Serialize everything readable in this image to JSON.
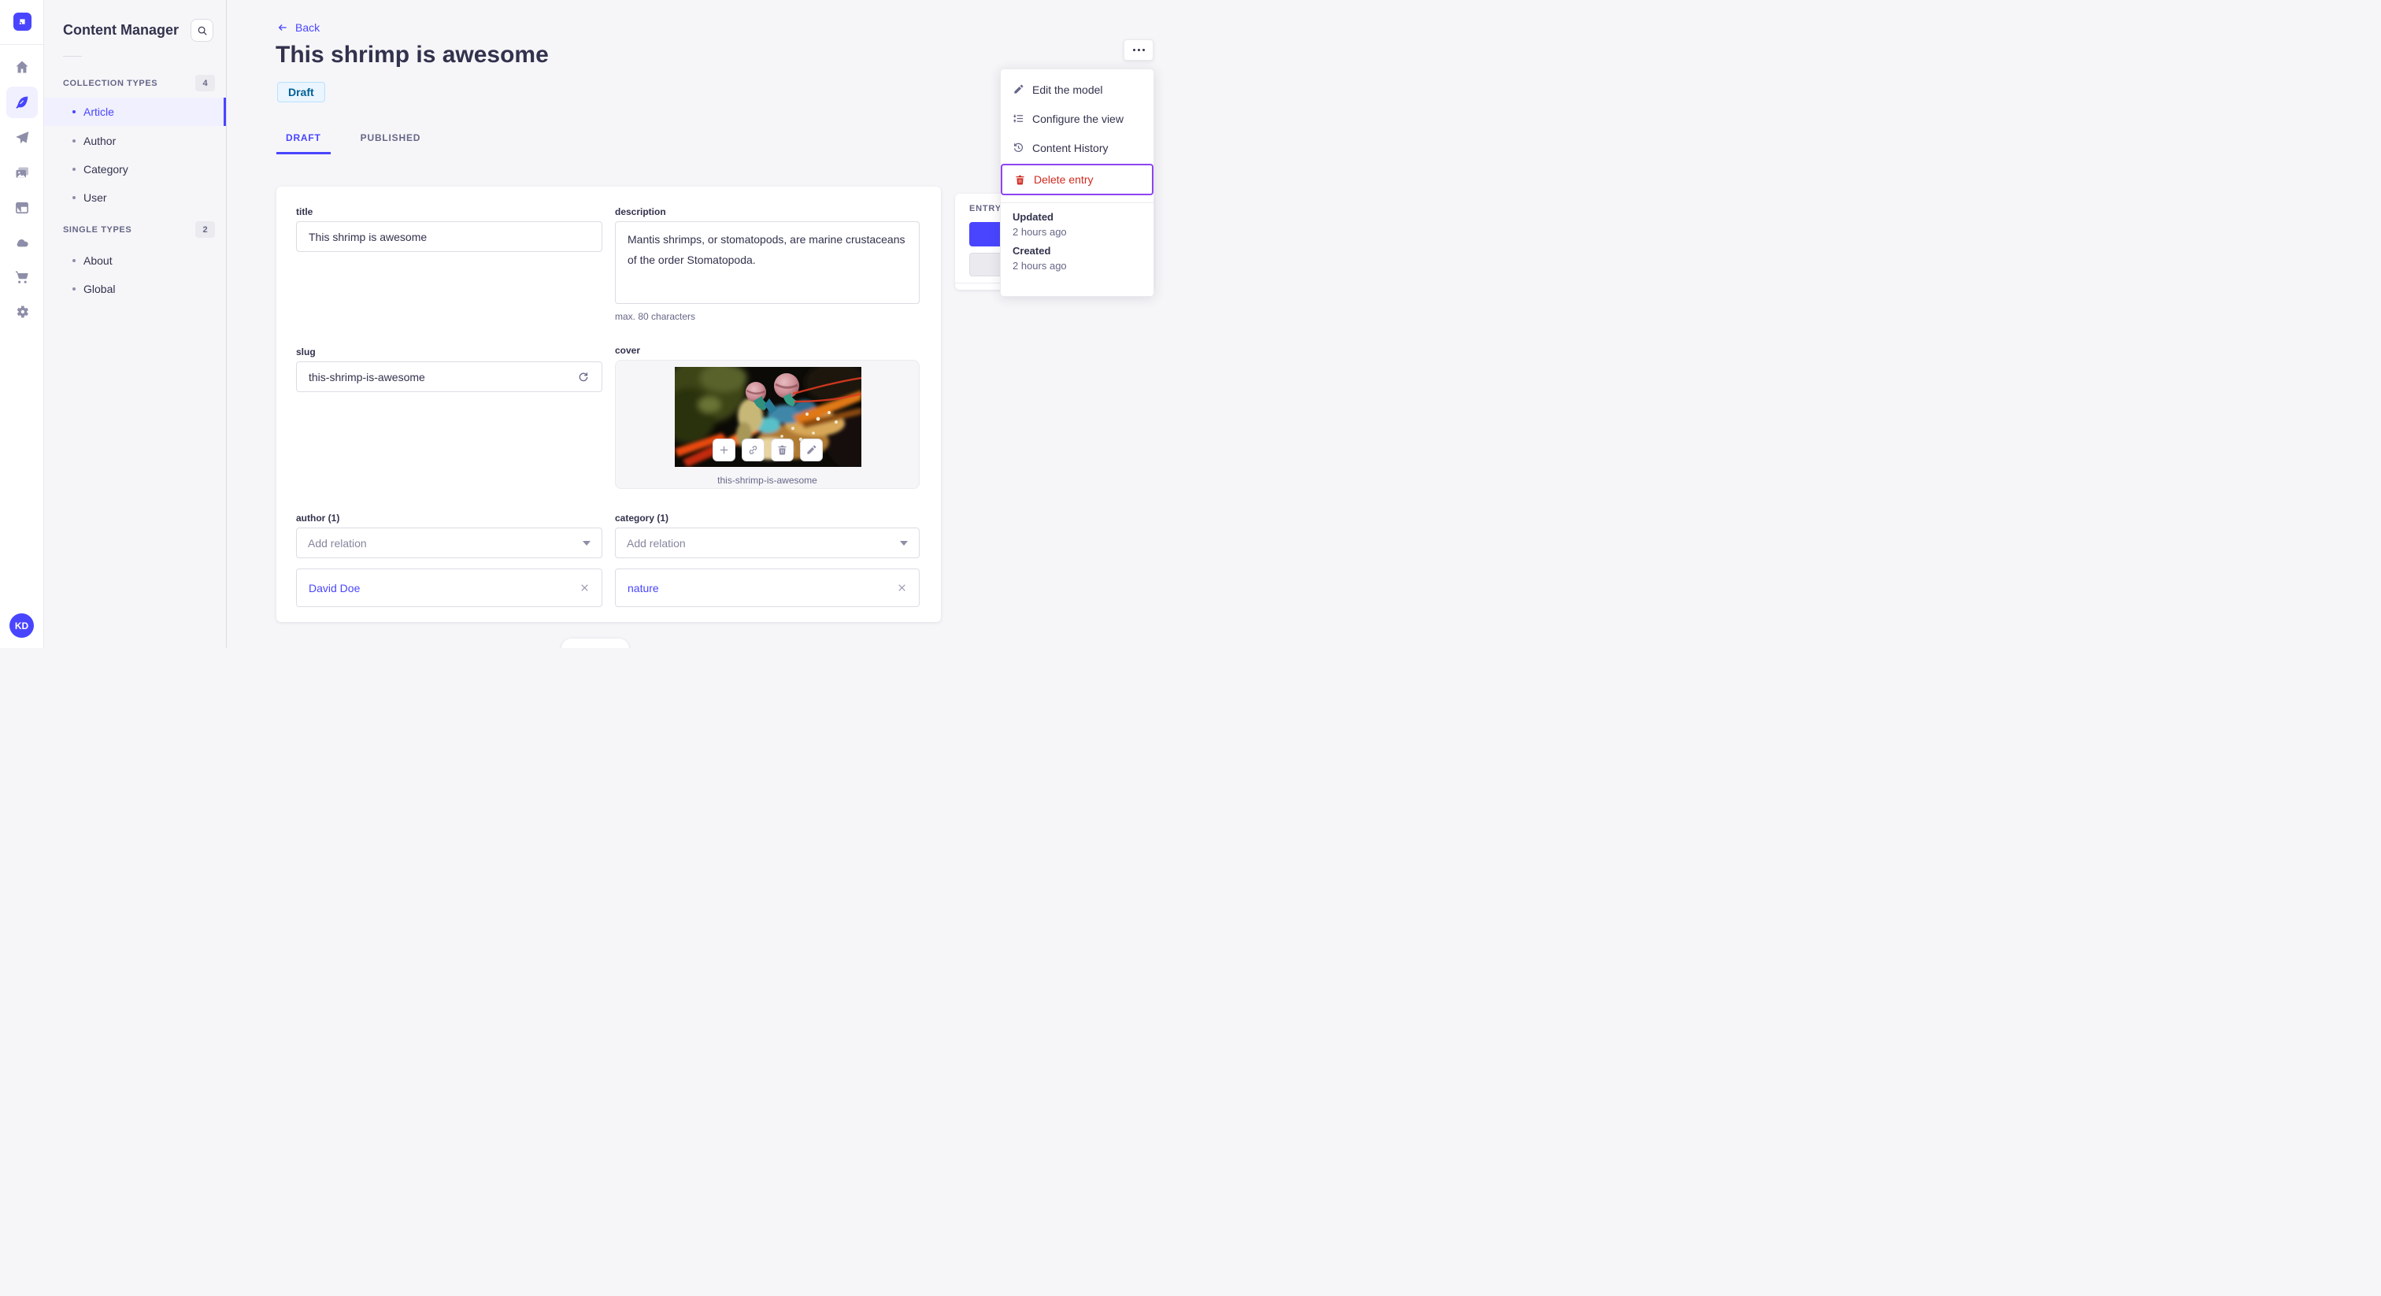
{
  "colors": {
    "accent": "#4945FF",
    "accent_bg": "#F0F0FF",
    "danger": "#D02B20",
    "focus_ring": "#8E44F0",
    "draft_bg": "#EAF5FF",
    "draft_border": "#B8E1FF",
    "draft_text": "#006096",
    "text_dark": "#32324D",
    "text_gray": "#666687",
    "border": "#DCDCE4",
    "page_bg": "#F6F6F9"
  },
  "rail": {
    "logo_icon": "strapi-logo",
    "icons": [
      "home-icon",
      "content-feather-icon",
      "send-icon",
      "media-library-icon",
      "layout-icon",
      "cloud-icon",
      "marketplace-cart-icon",
      "settings-gear-icon"
    ],
    "active_icon": "content-feather-icon",
    "avatar_initials": "KD"
  },
  "sidebar": {
    "title": "Content Manager",
    "search_icon": "search-icon",
    "sections": [
      {
        "label": "COLLECTION TYPES",
        "count": "4",
        "items": [
          {
            "label": "Article",
            "active": true
          },
          {
            "label": "Author",
            "active": false
          },
          {
            "label": "Category",
            "active": false
          },
          {
            "label": "User",
            "active": false
          }
        ]
      },
      {
        "label": "SINGLE TYPES",
        "count": "2",
        "items": [
          {
            "label": "About",
            "active": false
          },
          {
            "label": "Global",
            "active": false
          }
        ]
      }
    ]
  },
  "header": {
    "back_label": "Back",
    "back_icon": "arrow-left-icon",
    "title": "This shrimp is awesome",
    "status": "Draft",
    "more_icon": "ellipsis-icon"
  },
  "tabs": [
    {
      "label": "DRAFT",
      "active": true
    },
    {
      "label": "PUBLISHED",
      "active": false
    }
  ],
  "form": {
    "title": {
      "label": "title",
      "value": "This shrimp is awesome"
    },
    "description": {
      "label": "description",
      "value": "Mantis shrimps, or stomatopods, are marine crustaceans of the order Stomatopoda.",
      "helper": "max. 80 characters"
    },
    "slug": {
      "label": "slug",
      "value": "this-shrimp-is-awesome",
      "regenerate_icon": "refresh-icon"
    },
    "cover": {
      "label": "cover",
      "caption": "this-shrimp-is-awesome",
      "toolbar_icons": [
        "plus-icon",
        "link-icon",
        "trash-icon",
        "pencil-icon"
      ]
    },
    "author": {
      "label": "author (1)",
      "placeholder": "Add relation",
      "items": [
        "David Doe"
      ],
      "remove_icon": "close-icon"
    },
    "category": {
      "label": "category (1)",
      "placeholder": "Add relation",
      "items": [
        "nature"
      ],
      "remove_icon": "close-icon"
    }
  },
  "entry_panel": {
    "title": "ENTRY"
  },
  "menu": {
    "items": [
      {
        "label": "Edit the model",
        "icon": "pencil-icon"
      },
      {
        "label": "Configure the view",
        "icon": "configure-list-icon"
      },
      {
        "label": "Content History",
        "icon": "history-clock-icon"
      },
      {
        "label": "Delete entry",
        "icon": "trash-icon",
        "danger": true,
        "focused": true
      }
    ],
    "meta": [
      {
        "label": "Updated",
        "value": "2 hours ago"
      },
      {
        "label": "Created",
        "value": "2 hours ago"
      }
    ]
  }
}
